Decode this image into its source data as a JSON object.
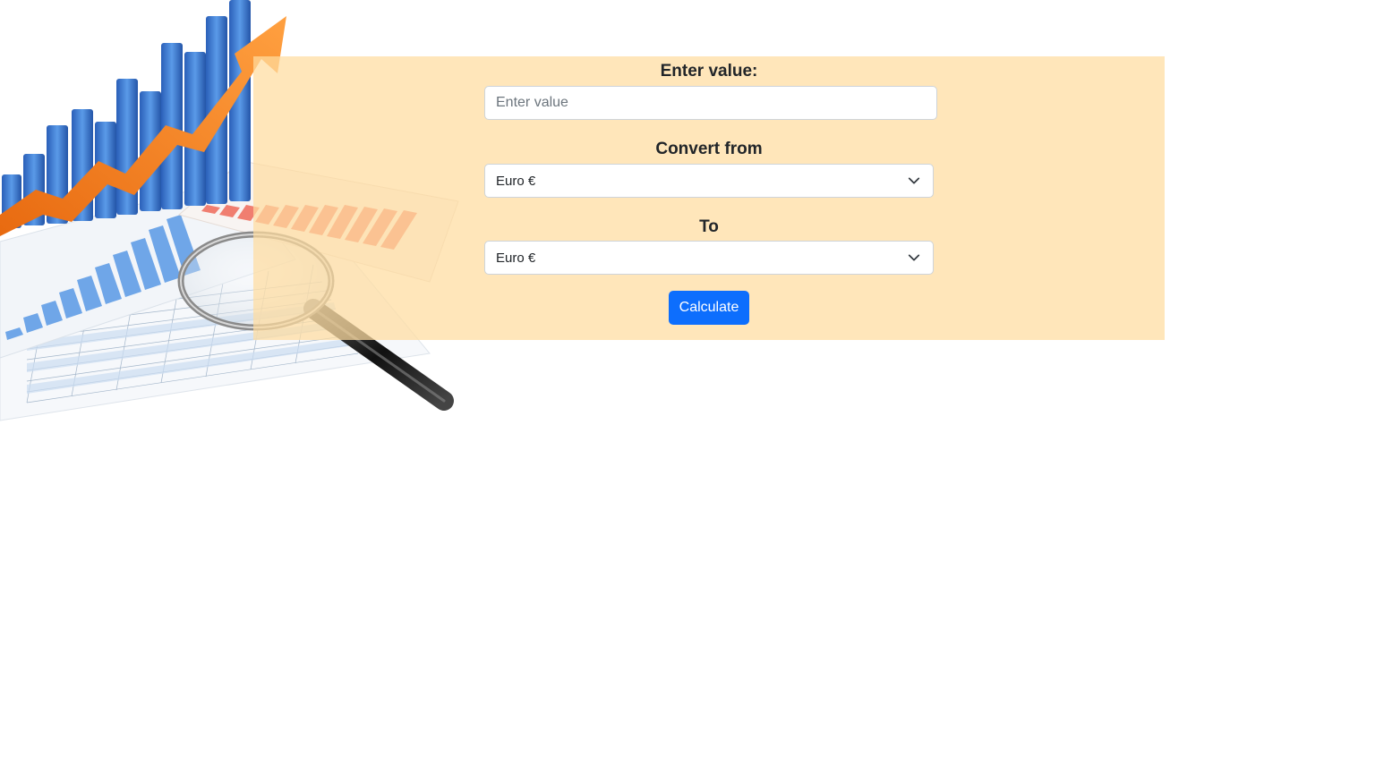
{
  "form": {
    "value_label": "Enter value:",
    "value_placeholder": "Enter value",
    "value_current": "",
    "from_label": "Convert from",
    "from_selected": "Euro €",
    "to_label": "To",
    "to_selected": "Euro €",
    "calculate_label": "Calculate"
  },
  "illustration": {
    "icon": "financial-chart-magnifier-illustration",
    "colors": {
      "bars": "#3f7fd6",
      "arrow": "#f7861e",
      "panel_bg": "#ffe2b4",
      "button": "#0d6efd"
    }
  }
}
